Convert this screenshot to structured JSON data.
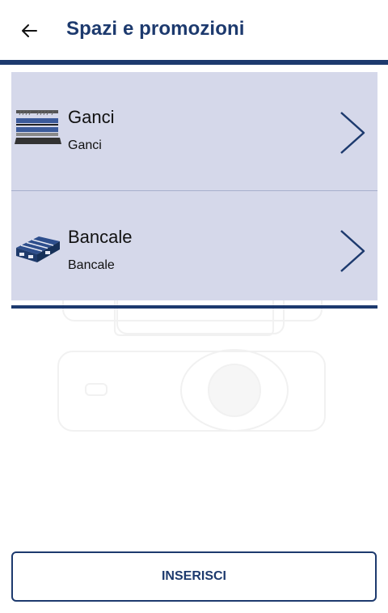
{
  "header": {
    "title": "Spazi e promozioni",
    "back_icon": "arrow-left-icon"
  },
  "list": {
    "items": [
      {
        "title": "Ganci",
        "subtitle": "Ganci",
        "icon": "hooks-shelf-icon"
      },
      {
        "title": "Bancale",
        "subtitle": "Bancale",
        "icon": "pallet-icon"
      }
    ]
  },
  "actions": {
    "insert_label": "INSERISCI"
  },
  "colors": {
    "primary": "#1d3a6e",
    "list_background": "#d5d8ea"
  }
}
